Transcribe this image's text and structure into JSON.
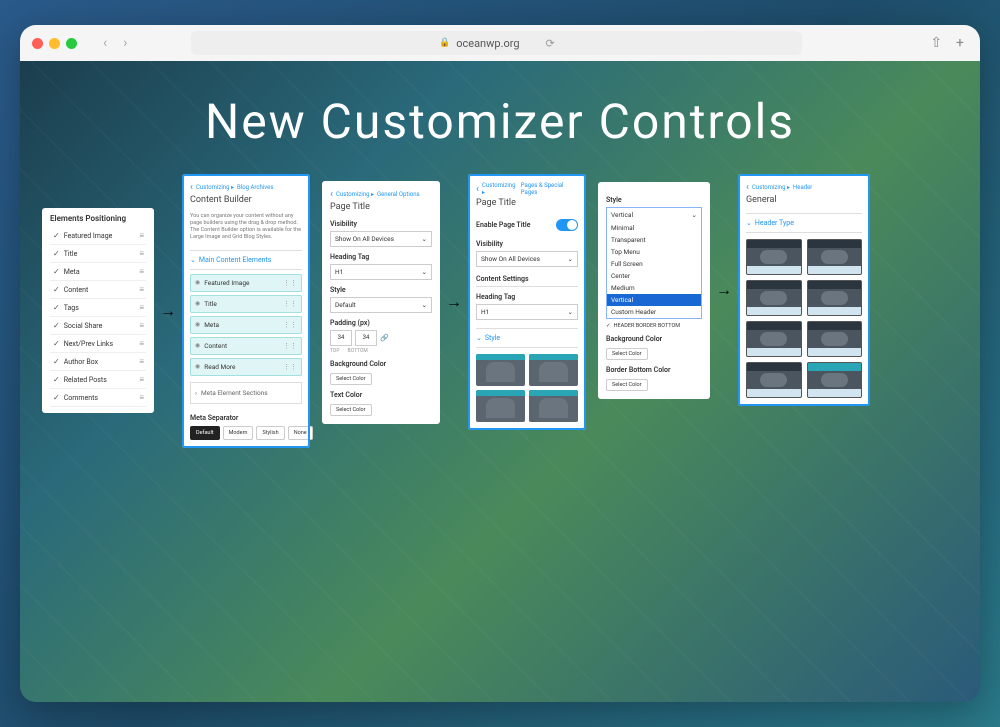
{
  "browser": {
    "url": "oceanwp.org"
  },
  "hero": {
    "title": "New Customizer Controls"
  },
  "panelA": {
    "section": "Elements Positioning",
    "items": [
      "Featured Image",
      "Title",
      "Meta",
      "Content",
      "Tags",
      "Social Share",
      "Next/Prev Links",
      "Author Box",
      "Related Posts",
      "Comments"
    ]
  },
  "panelB": {
    "breadcrumb_prefix": "Customizing ▸",
    "breadcrumb_section": "Blog Archives",
    "title": "Content Builder",
    "desc": "You can organize your content without any page builders using the drag & drop method. The Content Builder option is available for the Large Image and Grid Blog Styles.",
    "collapse_label": "Main Content Elements",
    "items": [
      "Featured Image",
      "Title",
      "Meta",
      "Content",
      "Read More"
    ],
    "accordion": "Meta Element Sections",
    "separator_label": "Meta Separator",
    "separator_options": [
      "Default",
      "Modern",
      "Stylish",
      "None"
    ]
  },
  "panelC": {
    "breadcrumb_prefix": "Customizing ▸",
    "breadcrumb_section": "General Options",
    "title": "Page Title",
    "visibility_label": "Visibility",
    "visibility_value": "Show On All Devices",
    "heading_tag_label": "Heading Tag",
    "heading_tag_value": "H1",
    "style_label": "Style",
    "style_value": "Default",
    "padding_label": "Padding (px)",
    "padding_top": "34",
    "padding_bottom": "34",
    "padding_top_label": "TOP",
    "padding_bottom_label": "BOTTOM",
    "bg_color_label": "Background Color",
    "text_color_label": "Text Color",
    "select_color": "Select Color"
  },
  "panelD": {
    "breadcrumb_prefix": "Customizing ▸",
    "breadcrumb_section": "Pages & Special Pages",
    "title": "Page Title",
    "enable_label": "Enable Page Title",
    "visibility_label": "Visibility",
    "visibility_value": "Show On All Devices",
    "content_settings": "Content Settings",
    "heading_tag_label": "Heading Tag",
    "heading_tag_value": "H1",
    "style_collapse": "Style"
  },
  "panelE": {
    "style_label": "Style",
    "dropdown_selected": "Vertical",
    "dropdown_items": [
      "Minimal",
      "Transparent",
      "Top Menu",
      "Full Screen",
      "Center",
      "Medium",
      "Vertical",
      "Custom Header"
    ],
    "header_border_label": "HEADER BORDER BOTTOM",
    "bg_color_label": "Background Color",
    "border_color_label": "Border Bottom Color",
    "select_color": "Select Color"
  },
  "panelF": {
    "breadcrumb_prefix": "Customizing ▸",
    "breadcrumb_section": "Header",
    "title": "General",
    "header_type_label": "Header Type",
    "thumb_labels": [
      "",
      "",
      "",
      "",
      "",
      "",
      "",
      ""
    ]
  }
}
